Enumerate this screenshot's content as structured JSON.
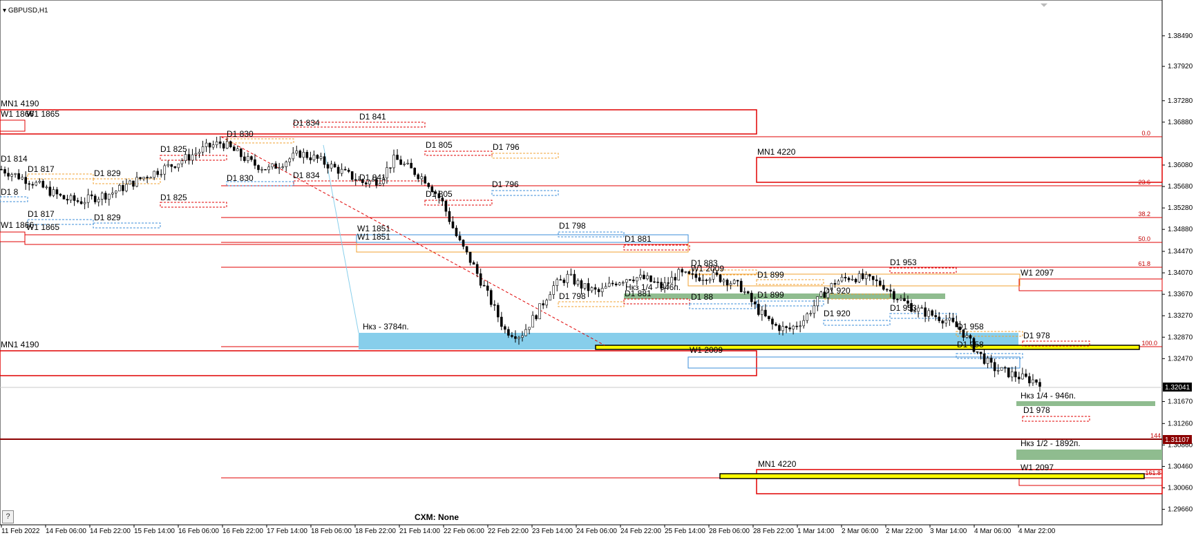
{
  "window": {
    "symbol_label": "GBPUSD,H1",
    "broker_label": "CXM: None",
    "help_label": "?"
  },
  "colors": {
    "candle": "#000000",
    "red": "#e00000",
    "dark_red": "#8b0000",
    "orange": "#f0a030",
    "blue": "#3b8ed8",
    "zone_blue": "#87ceeb",
    "zone_green": "#8fbc8f",
    "yellow": "#ffff00"
  },
  "chart_data": {
    "type": "candlestick",
    "symbol": "GBPUSD",
    "timeframe": "H1",
    "price_range": [
      1.295,
      1.389
    ],
    "y_ticks": [
      "1.38490",
      "1.37920",
      "1.37280",
      "1.36880",
      "1.36080",
      "1.35680",
      "1.35280",
      "1.34880",
      "1.34470",
      "1.34070",
      "1.33670",
      "1.33270",
      "1.32870",
      "1.32470",
      "1.31670",
      "1.31260",
      "1.30860",
      "1.30460",
      "1.30060",
      "1.29660"
    ],
    "x_ticks": [
      "11 Feb 2022",
      "14 Feb 06:00",
      "14 Feb 22:00",
      "15 Feb 14:00",
      "16 Feb 06:00",
      "16 Feb 22:00",
      "17 Feb 14:00",
      "18 Feb 06:00",
      "18 Feb 22:00",
      "21 Feb 14:00",
      "22 Feb 06:00",
      "22 Feb 22:00",
      "23 Feb 14:00",
      "24 Feb 06:00",
      "24 Feb 22:00",
      "25 Feb 14:00",
      "28 Feb 06:00",
      "28 Feb 22:00",
      "1 Mar 14:00",
      "2 Mar 06:00",
      "2 Mar 22:00",
      "3 Mar 14:00",
      "4 Mar 06:00",
      "4 Mar 22:00"
    ],
    "current_price": "1.32041",
    "level_price": "1.31107",
    "close_path": [
      1.36,
      1.3588,
      1.3576,
      1.356,
      1.3545,
      1.354,
      1.3548,
      1.3556,
      1.357,
      1.3585,
      1.3598,
      1.361,
      1.3625,
      1.364,
      1.365,
      1.363,
      1.361,
      1.36,
      1.3615,
      1.363,
      1.362,
      1.3605,
      1.359,
      1.3575,
      1.358,
      1.362,
      1.36,
      1.358,
      1.354,
      1.347,
      1.342,
      1.336,
      1.33,
      1.329,
      1.333,
      1.338,
      1.34,
      1.338,
      1.337,
      1.339,
      1.34,
      1.3395,
      1.338,
      1.3405,
      1.3398,
      1.3402,
      1.3395,
      1.338,
      1.334,
      1.331,
      1.33,
      1.332,
      1.336,
      1.339,
      1.34,
      1.3395,
      1.3385,
      1.336,
      1.334,
      1.333,
      1.332,
      1.33,
      1.326,
      1.323,
      1.322,
      1.321,
      1.3204
    ]
  },
  "zone_labels": {
    "mn1_4190_top": "MN1 4190",
    "w1_1865_top": "W1 1865",
    "w1_1866": "W1 1866",
    "d1_841_a": "D1 841",
    "d1_834_a": "D1 834",
    "d1_830_a": "D1 830",
    "d1_814": "D1 814",
    "d1_817_a": "D1 817",
    "d1_829_a": "D1 829",
    "d1_825_a": "D1 825",
    "d1_805_a": "D1 805",
    "d1_796_a": "D1 796",
    "mn1_4220_top": "MN1 4220",
    "d1_830_b": "D1 830",
    "d1_834_b": "D1 834",
    "d1_841_b": "D1 841",
    "d1_825_b": "D1 825",
    "d1_817_b": "D1 817",
    "d1_829_b": "D1 829",
    "d1_805_b": "D1 805",
    "d1_796_b": "D1 796",
    "d1_8xx": "D1 8",
    "w1_1866_b": "W1 1866",
    "w1_1865_b": "W1 1865",
    "w1_1851_a": "W1 1851",
    "w1_1851_b": "W1 1851",
    "d1_798_a": "D1 798",
    "d1_881_a": "D1 881",
    "d1_883": "D1 883",
    "w1_2009_a": "W1 2009",
    "d1_899_a": "D1 899",
    "d1_953_a": "D1 953",
    "w1_2097_a": "W1 2097",
    "nkz_1_4_a": "Нкз 1/4 - 946п.",
    "d1_881_b": "D1 881",
    "d1_88x": "D1 88",
    "d1_899_b": "D1 899",
    "d1_920_a": "D1 920",
    "d1_798_b": "D1 798",
    "d1_920_b": "D1 920",
    "d1_953_b": "D1 953",
    "nkz_3784": "Нкз - 3784п.",
    "d1_958_a": "D1 958",
    "d1_978_a": "D1 978",
    "mn1_4190_b": "MN1 4190",
    "d1_958_b": "D1 958",
    "w1_2009_b": "W1 2009",
    "nkz_1_4_b": "Нкз 1/4 - 946п.",
    "d1_978_b": "D1 978",
    "nkz_1_2": "Нкз 1/2 - 1892п.",
    "mn1_4220_b": "MN1 4220",
    "w1_2097_b": "W1 2097"
  },
  "fib_labels": {
    "f0": "0.0",
    "f236": "23.6",
    "f382": "38.2",
    "f50": "50.0",
    "f618": "61.8",
    "f100": "100.0",
    "f144": "144",
    "f1618": "161.8"
  }
}
